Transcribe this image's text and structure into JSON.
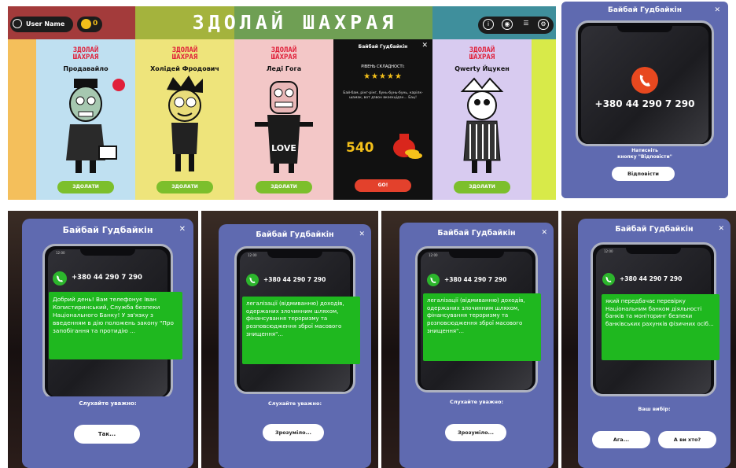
{
  "game": {
    "title": "ЗДОЛАЙ ШАХРАЯ",
    "user_name": "User Name",
    "coins": "0",
    "logo_line1": "ЗДОЛАЙ",
    "logo_line2": "ШАХРАЯ",
    "cards": [
      {
        "name": "Продавайло",
        "button": "ЗДОЛАТИ"
      },
      {
        "name": "Холідей Фродович",
        "button": "ЗДОЛАТИ"
      },
      {
        "name": "Леді Гога",
        "button": "ЗДОЛАТИ"
      },
      {
        "name": "Qwerty Йцукен",
        "button": "ЗДОЛАТИ"
      }
    ],
    "dark_card": {
      "title": "Байбай Гудбайкін",
      "difficulty_label": "РІВЕНЬ СКЛАДНОСТІ:",
      "stars": "★★★★★",
      "text": "Бай-бам, рінг-рінг, бунь-бунь-бунь, карілк-шамак, вот дзвон вкоєкцідзн... Бац!",
      "score": "540",
      "go_label": "GO!"
    },
    "colors": {
      "pink": "#e0203a",
      "green": "#7cbf2c",
      "gold": "#f4c01a",
      "red": "#e3412c"
    }
  },
  "popups": {
    "title": "Байбай Гудбайкін",
    "phone_time": "12:00",
    "number": "+380 44 290 7 290",
    "first": {
      "hint_line1": "Натисніть",
      "hint_line2": "кнопку \"Відповісти\"",
      "button": "Відповісти"
    },
    "p1": {
      "message": "Добрий день! Вам телефонує Іван Копистиринський, Служба безпеки Національного Банку! У зв'язку з введенням в дію положень закону \"Про запобігання та протидію ...",
      "hint": "Слухайте уважно:",
      "button": "Так..."
    },
    "p2": {
      "message": "легалізації (відмиванню) доходів, одержаних злочинним шляхом, фінансування тероризму та розповсюдження зброї масового знищення\"...",
      "hint": "Слухайте уважно:",
      "button": "Зрозуміло..."
    },
    "p3": {
      "message": "легалізації (відмиванню) доходів, одержаних злочинним шляхом, фінансування тероризму та розповсюдження зброї масового знищення\"...",
      "hint": "Слухайте уважно:",
      "button": "Зрозуміло..."
    },
    "p4": {
      "message": "який передбачає перевірку Національним банком діяльності банків та моніторинг безпеки банківських рахунків фізичних осіб...",
      "hint": "Ваш вибір:",
      "button_a": "Ага...",
      "button_b": "А ви хто?"
    },
    "accent": "#5f6ab0",
    "bubble_green": "#1fb81f",
    "call_red": "#e8481f"
  }
}
